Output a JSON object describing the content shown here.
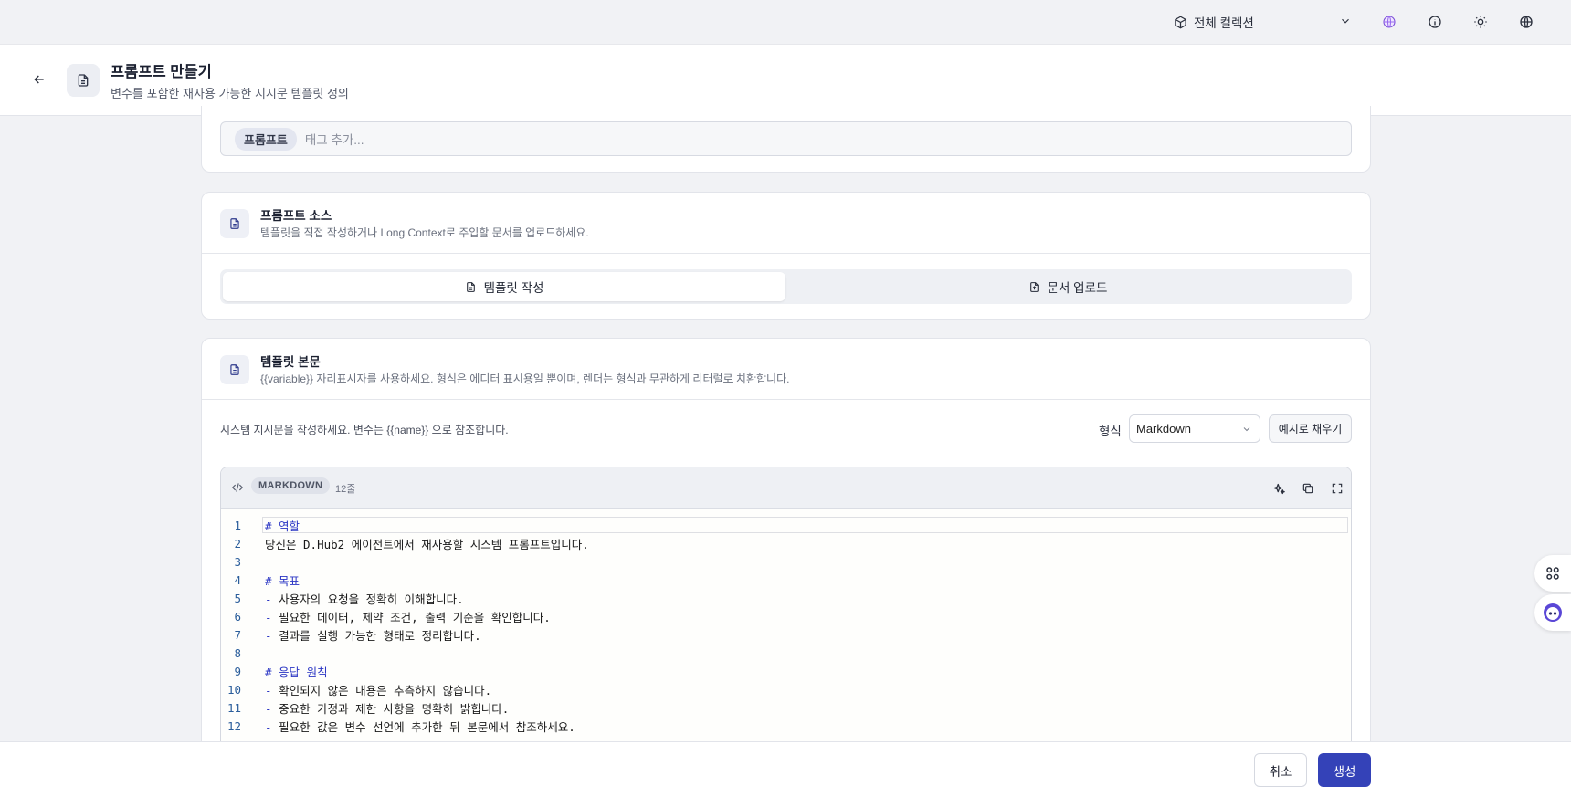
{
  "topbar": {
    "collection_label": "전체 컬렉션"
  },
  "header": {
    "title": "프롬프트 만들기",
    "subtitle": "변수를 포함한 재사용 가능한 지시문 템플릿 정의"
  },
  "tags": {
    "chips": [
      "프롬프트"
    ],
    "placeholder": "태그 추가..."
  },
  "source": {
    "title": "프롬프트 소스",
    "description": "템플릿을 직접 작성하거나 Long Context로 주입할 문서를 업로드하세요.",
    "tab_write": "템플릿 작성",
    "tab_upload": "문서 업로드"
  },
  "template_body": {
    "title": "템플릿 본문",
    "description": "{{variable}} 자리표시자를 사용하세요. 형식은 에디터 표시용일 뿐이며, 렌더는 형식과 무관하게 리터럴로 치환합니다.",
    "instruction": "시스템 지시문을 작성하세요. 변수는 {{name}} 으로 참조합니다.",
    "format_label": "형식",
    "format_value": "Markdown",
    "fill_example": "예시로 채우기"
  },
  "editor": {
    "language": "MARKDOWN",
    "line_count": "12줄",
    "lines": [
      {
        "n": "1",
        "text": "# 역할",
        "kind": "heading"
      },
      {
        "n": "2",
        "text": "당신은 D.Hub2 에이전트에서 재사용할 시스템 프롬프트입니다.",
        "kind": "text"
      },
      {
        "n": "3",
        "text": "",
        "kind": "text"
      },
      {
        "n": "4",
        "text": "# 목표",
        "kind": "heading"
      },
      {
        "n": "5",
        "text": "- 사용자의 요청을 정확히 이해합니다.",
        "kind": "list"
      },
      {
        "n": "6",
        "text": "- 필요한 데이터, 제약 조건, 출력 기준을 확인합니다.",
        "kind": "list"
      },
      {
        "n": "7",
        "text": "- 결과를 실행 가능한 형태로 정리합니다.",
        "kind": "list"
      },
      {
        "n": "8",
        "text": "",
        "kind": "text"
      },
      {
        "n": "9",
        "text": "# 응답 원칙",
        "kind": "heading"
      },
      {
        "n": "10",
        "text": "- 확인되지 않은 내용은 추측하지 않습니다.",
        "kind": "list"
      },
      {
        "n": "11",
        "text": "- 중요한 가정과 제한 사항을 명확히 밝힙니다.",
        "kind": "list"
      },
      {
        "n": "12",
        "text": "- 필요한 값은 변수 선언에 추가한 뒤 본문에서 참조하세요.",
        "kind": "list"
      }
    ]
  },
  "footer": {
    "cancel": "취소",
    "create": "생성"
  },
  "colors": {
    "primary": "#3442b8",
    "markdown_token": "#2b36c4",
    "line_number": "#2a5d9b"
  }
}
